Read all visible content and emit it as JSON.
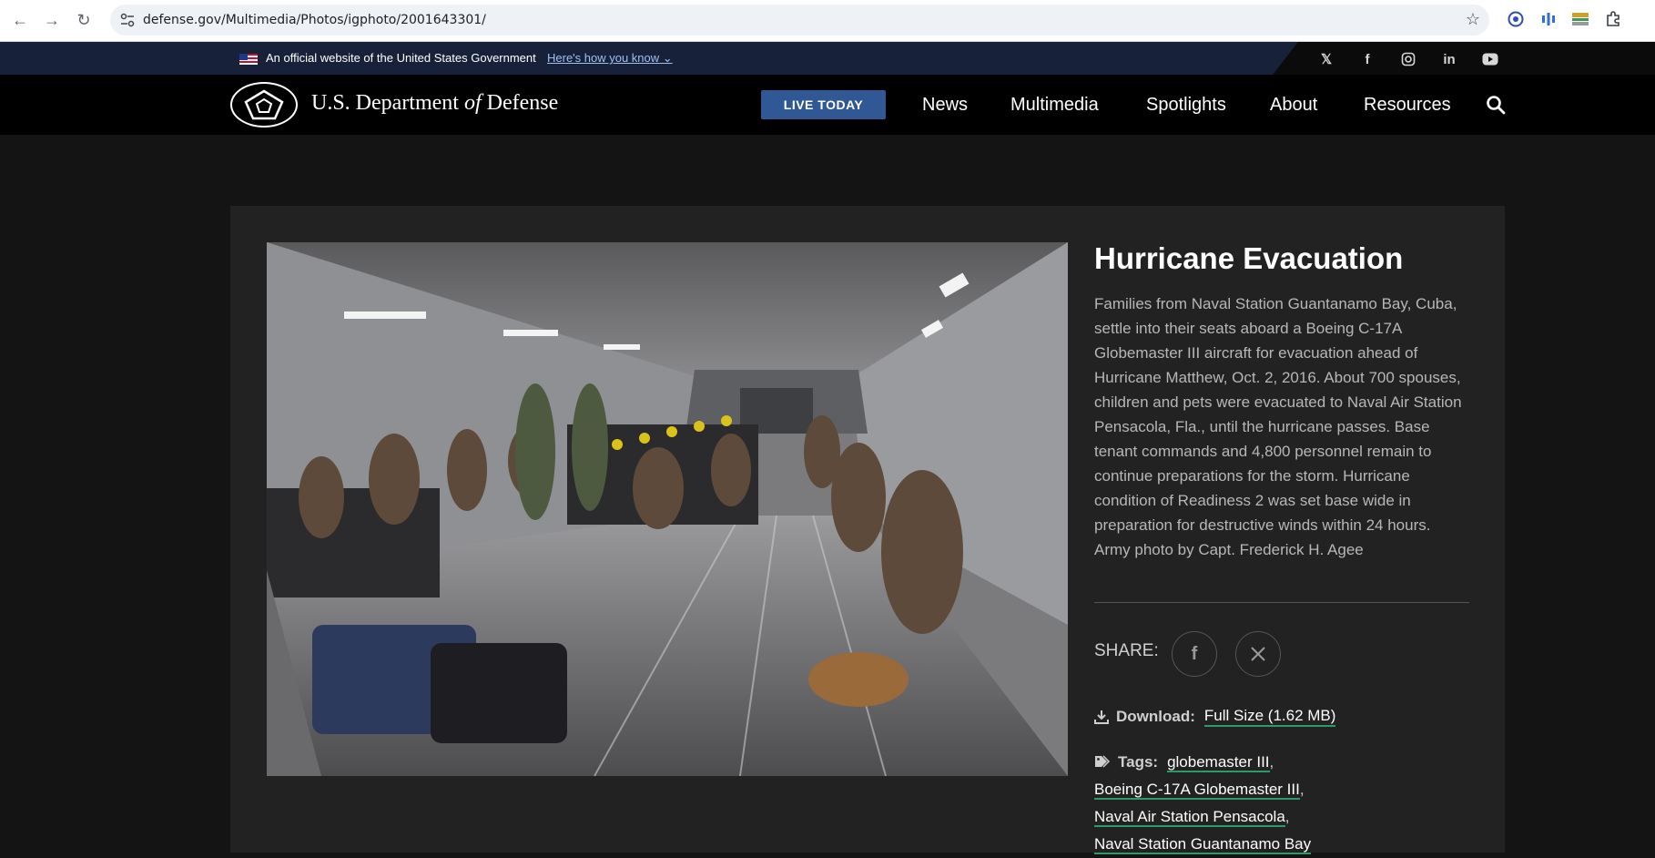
{
  "browser": {
    "url": "defense.gov/Multimedia/Photos/igphoto/2001643301/"
  },
  "gov_banner": {
    "text": "An official website of the United States Government",
    "link": "Here's how you know"
  },
  "header": {
    "brand_prefix": "U.S. Department",
    "brand_of": "of",
    "brand_suffix": "Defense",
    "live_button": "LIVE TODAY",
    "nav": [
      "News",
      "Multimedia",
      "Spotlights",
      "About",
      "Resources"
    ]
  },
  "photo_page": {
    "title": "Hurricane Evacuation",
    "description": "Families from Naval Station Guantanamo Bay, Cuba, settle into their seats aboard a Boeing C-17A Globemaster III aircraft for evacuation ahead of Hurricane Matthew, Oct. 2, 2016. About 700 spouses, children and pets were evacuated to Naval Air Station Pensacola, Fla., until the hurricane passes. Base tenant commands and 4,800 personnel remain to continue preparations for the storm. Hurricane condition of Readiness 2 was set base wide in preparation for destructive winds within 24 hours. Army photo by Capt. Frederick H. Agee",
    "share_label": "SHARE:",
    "download_label": "Download:",
    "download_link": "Full Size (1.62 MB)",
    "tags_label": "Tags:",
    "tags": [
      "globemaster III",
      "Boeing C-17A Globemaster III",
      "Naval Air Station Pensacola",
      "Naval Station Guantanamo Bay"
    ]
  }
}
